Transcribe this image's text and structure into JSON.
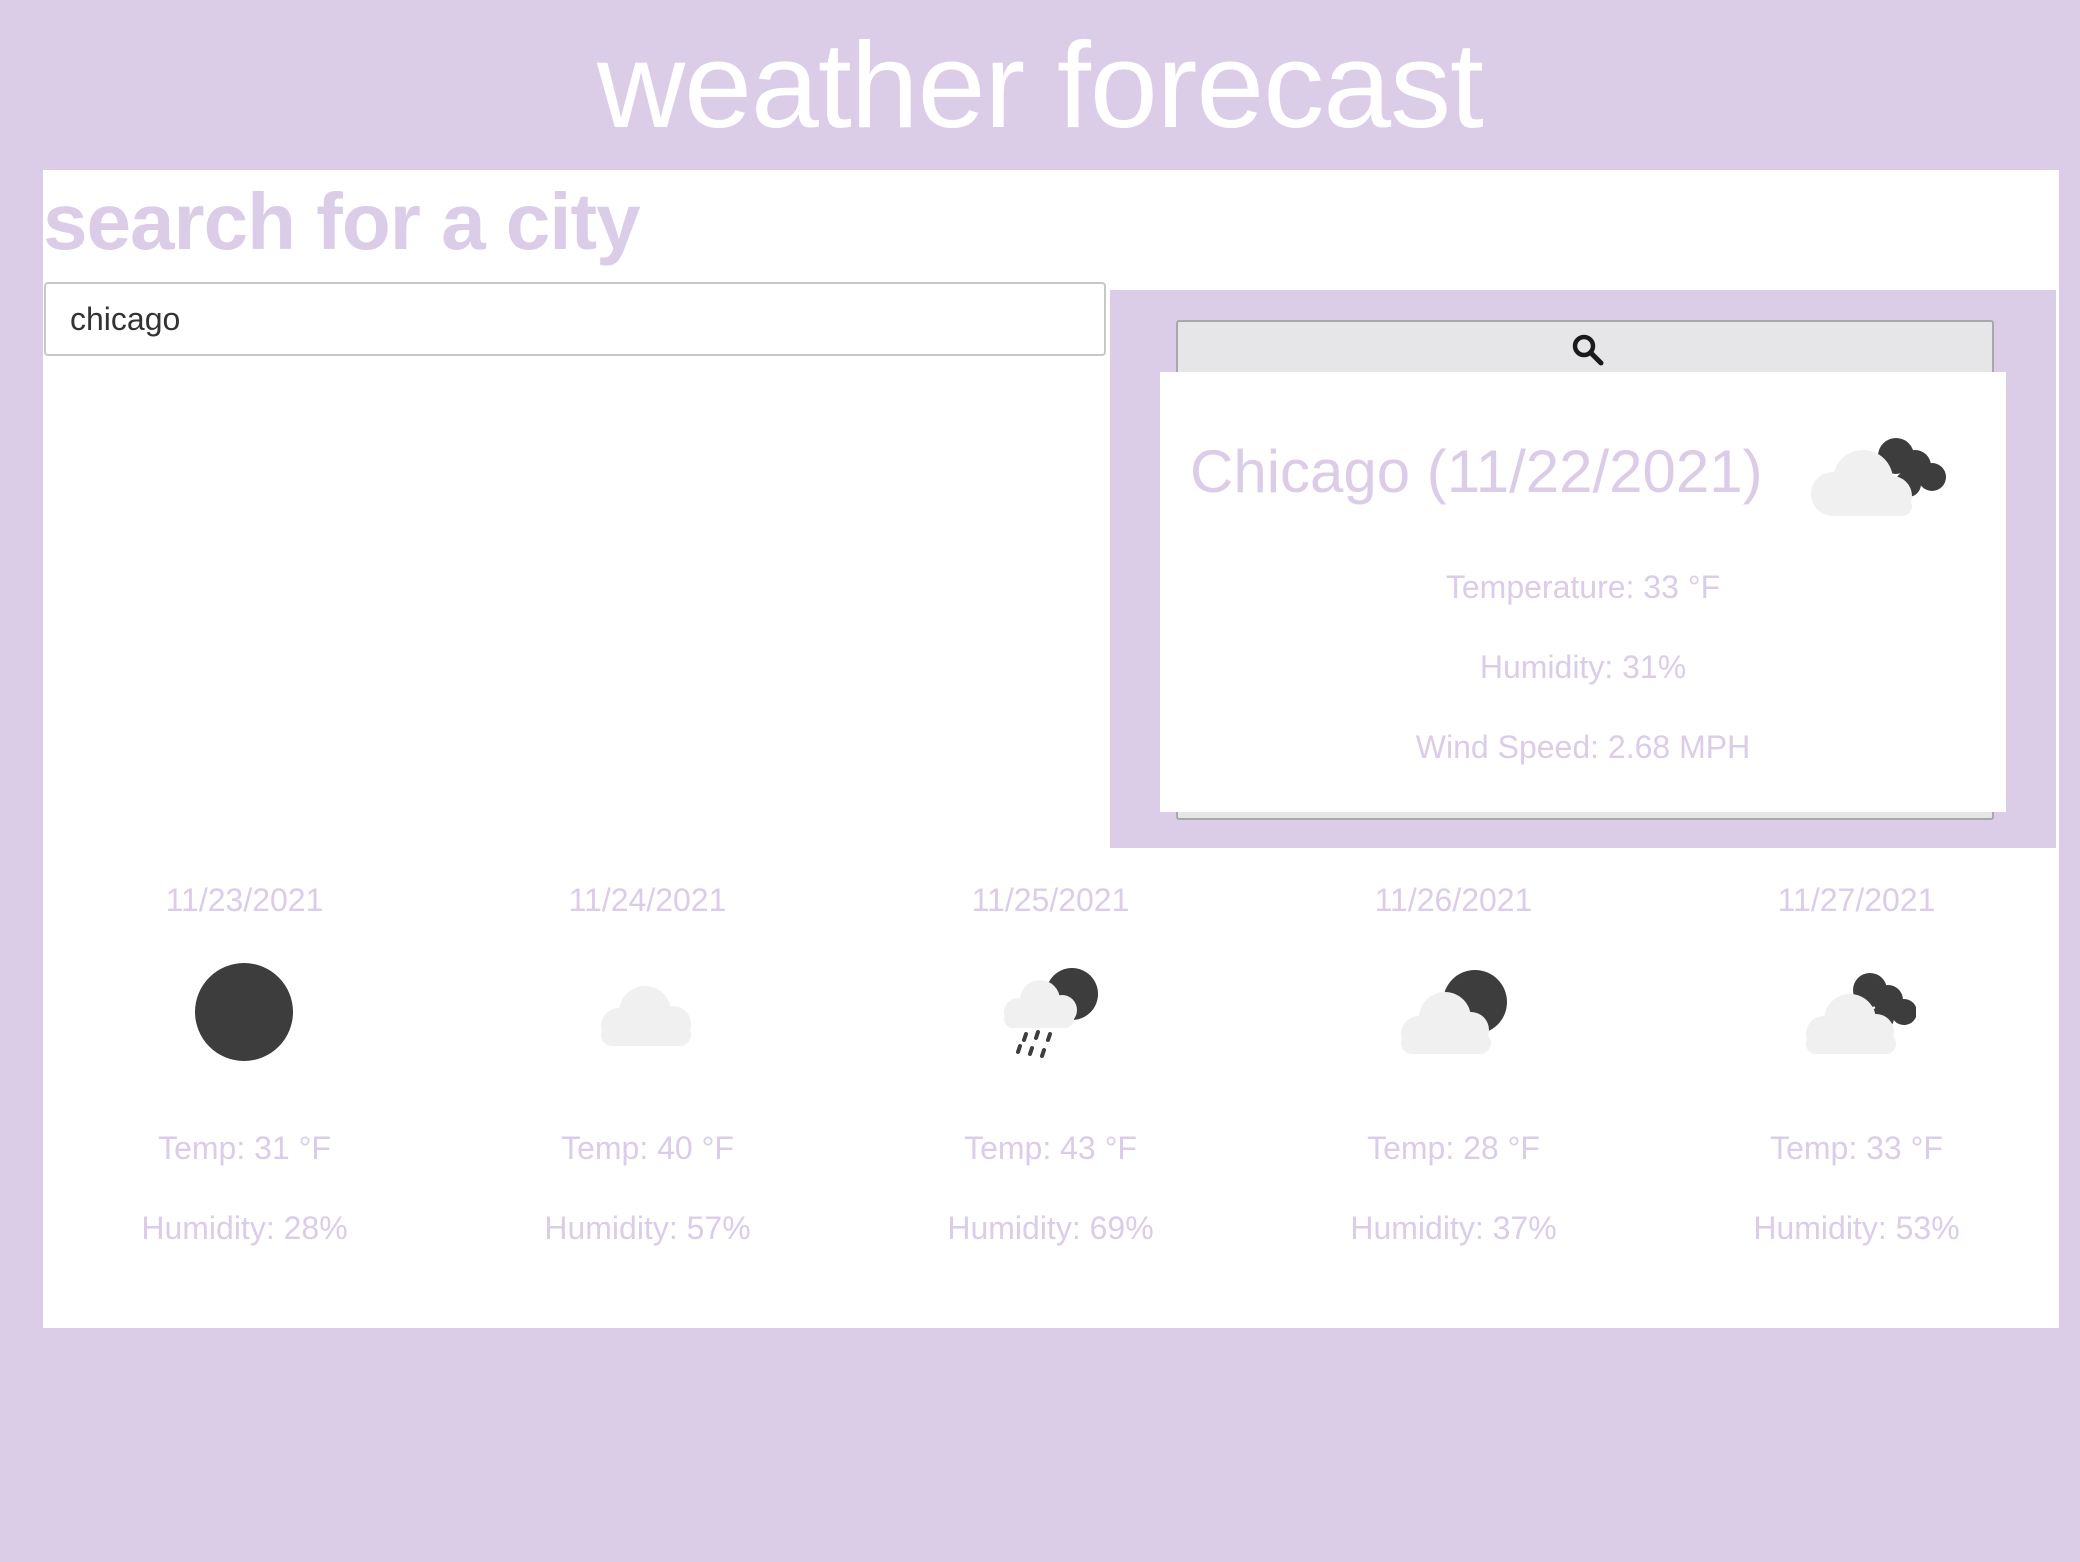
{
  "header": {
    "title": "weather forecast"
  },
  "search": {
    "heading": "search for a city",
    "input_value": "chicago",
    "button_icon": "search-icon"
  },
  "current": {
    "title": "Chicago (11/22/2021)",
    "icon": "cloud-moon-icon",
    "temperature": "Temperature: 33 °F",
    "humidity": "Humidity: 31%",
    "wind": "Wind Speed: 2.68 MPH"
  },
  "forecast": [
    {
      "date": "11/23/2021",
      "icon": "moon-icon",
      "temp": "Temp: 31 °F",
      "humidity": "Humidity: 28%"
    },
    {
      "date": "11/24/2021",
      "icon": "cloud-icon",
      "temp": "Temp: 40 °F",
      "humidity": "Humidity: 57%"
    },
    {
      "date": "11/25/2021",
      "icon": "cloud-rain-moon-icon",
      "temp": "Temp: 43 °F",
      "humidity": "Humidity: 69%"
    },
    {
      "date": "11/26/2021",
      "icon": "cloud-moon-icon",
      "temp": "Temp: 28 °F",
      "humidity": "Humidity: 37%"
    },
    {
      "date": "11/27/2021",
      "icon": "cloud-dark-clouds-icon",
      "temp": "Temp: 33 °F",
      "humidity": "Humidity: 53%"
    }
  ],
  "colors": {
    "background": "#dbcce8",
    "text_accent": "#dbcce8",
    "icon_dark": "#3d3d3d",
    "icon_cloud": "#f0f0f0"
  }
}
